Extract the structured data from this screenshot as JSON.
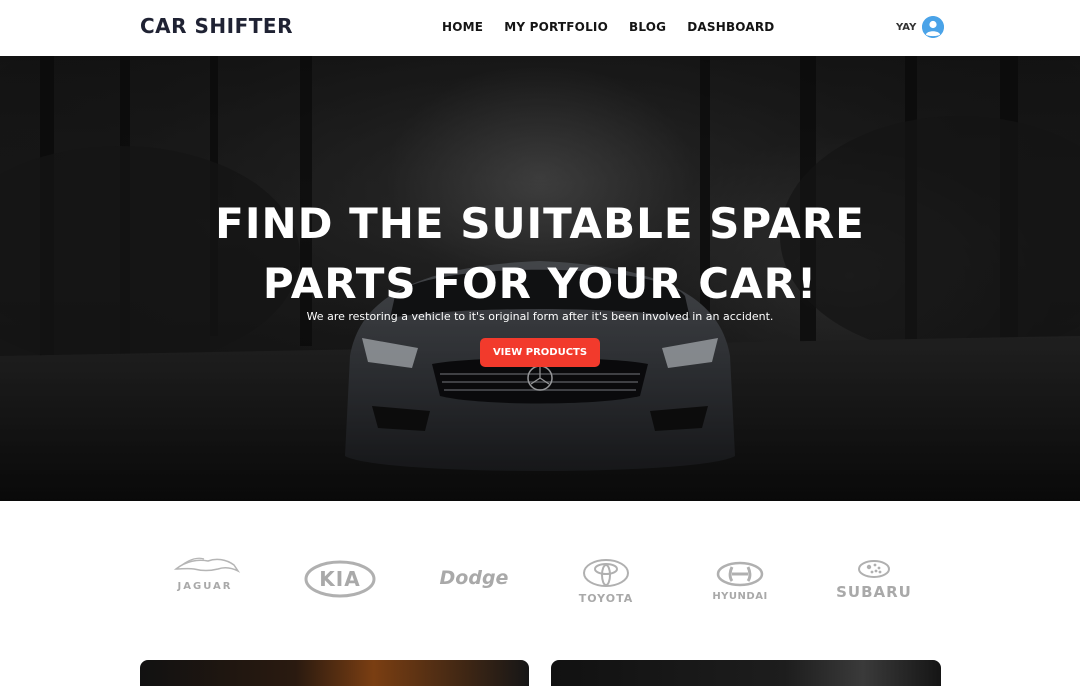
{
  "header": {
    "brand": "CAR SHIFTER",
    "nav": [
      "HOME",
      "MY PORTFOLIO",
      "BLOG",
      "DASHBOARD"
    ],
    "user_name": "YAY",
    "avatar_icon": "user-avatar-icon"
  },
  "hero": {
    "title_line1": "FIND THE SUITABLE SPARE",
    "title_line2": "PARTS FOR YOUR CAR!",
    "subtitle": "We are restoring a vehicle to it's original form after it's been involved in an accident.",
    "button_label": "VIEW PRODUCTS",
    "button_color": "#f23a2c"
  },
  "brands": [
    "JAGUAR",
    "KIA",
    "Dodge",
    "TOYOTA",
    "HYUNDAI",
    "SUBARU"
  ],
  "colors": {
    "accent": "#f23a2c",
    "logo_gray": "#b0b0b0"
  }
}
